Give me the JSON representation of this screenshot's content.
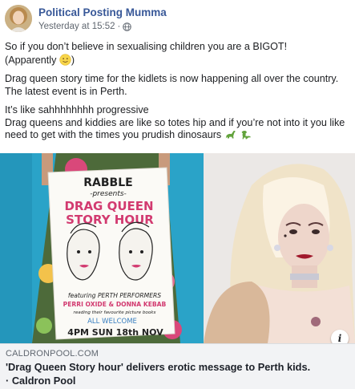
{
  "post": {
    "author": "Political Posting Mumma",
    "timestamp": "Yesterday at 15:52",
    "separator": "·",
    "privacy_icon": "globe-icon",
    "text": {
      "line1": "So if you don’t believe in sexualising children you are a BIGOT!",
      "line2": "(Apparently",
      "line2_end": ")",
      "para2_line1": "Drag queen story time for the kidlets is now happening all over the country.",
      "para2_line2": "The latest event is in Perth.",
      "para3_line1": "It’s like sahhhhhhhh progressive",
      "para3_line2": "Drag queens and kiddies are like so totes hip and if you’re not into it you like",
      "para3_line3": "need to get with the times you prudish dinosaurs"
    },
    "emojis": [
      "slightly-smiling-face",
      "sauropod",
      "t-rex"
    ]
  },
  "link": {
    "domain": "CALDRONPOOL.COM",
    "title_line1": "'Drag Queen Story hour' delivers erotic message to Perth kids.",
    "title_line2": "· Caldron Pool",
    "info_label": "i"
  },
  "poster": {
    "line1": "RABBLE",
    "line2": "-presents-",
    "line3": "DRAG QUEEN",
    "line4": "STORY HOUR",
    "line5": "featuring PERTH PERFORMERS",
    "line6": "PERRI OXIDE & DONNA KEBAB",
    "line7": "reading their favourite picture books",
    "line8": "ALL WELCOME",
    "line9": "4PM  SUN 18th NOV"
  },
  "colors": {
    "link_blue": "#385898",
    "meta_grey": "#606770",
    "caption_bg": "#f2f3f5",
    "poster_pink": "#e0457b",
    "wall_blue": "#2aa3c8"
  }
}
